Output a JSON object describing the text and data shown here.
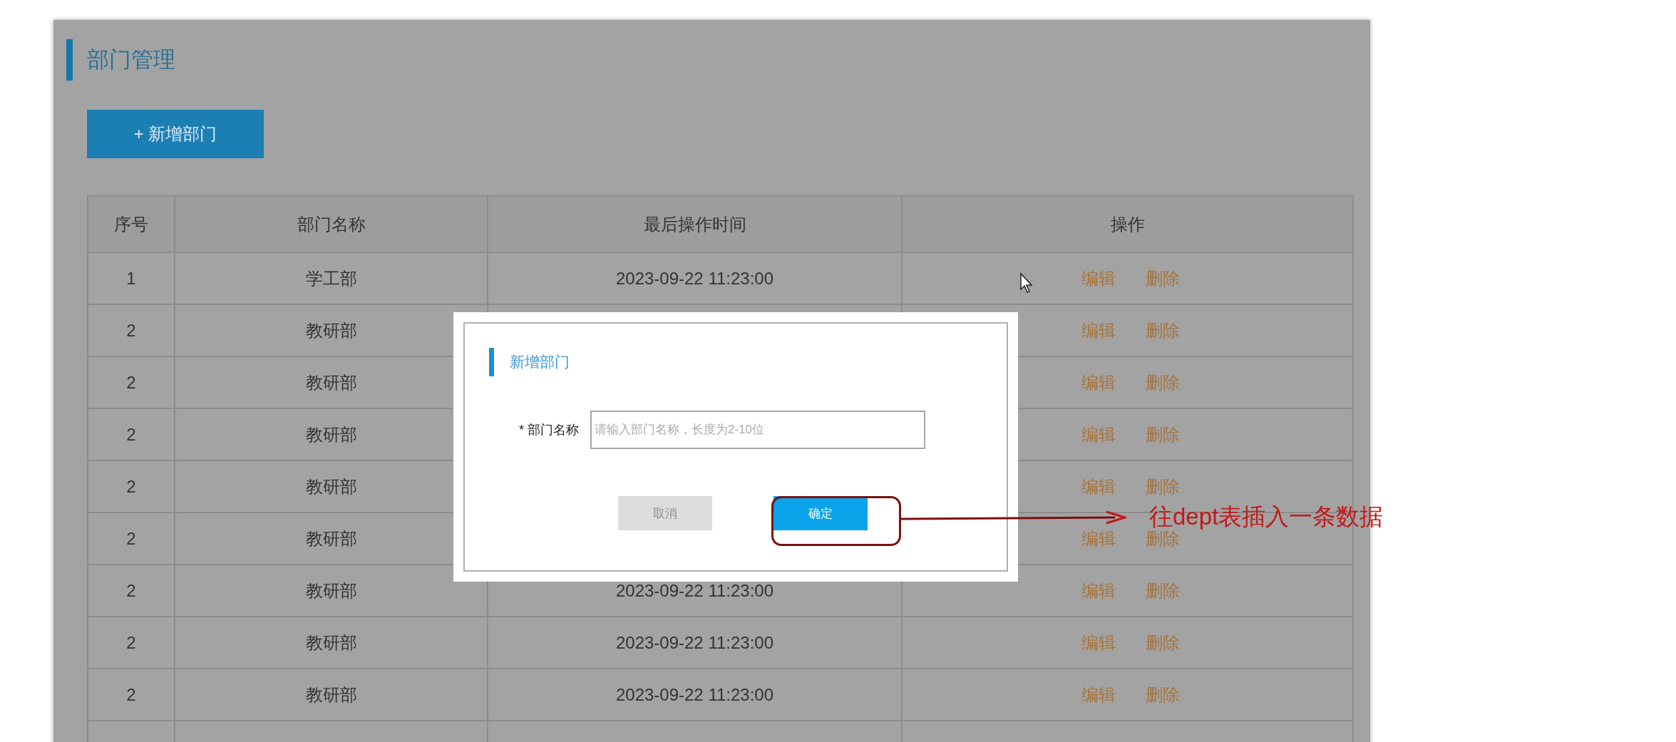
{
  "page": {
    "title": "部门管理",
    "add_button": "+ 新增部门"
  },
  "table": {
    "columns": [
      "序号",
      "部门名称",
      "最后操作时间",
      "操作"
    ],
    "rows": [
      {
        "index": "1",
        "name": "学工部",
        "time": "2023-09-22 11:23:00",
        "actions": [
          "编辑",
          "删除"
        ]
      },
      {
        "index": "2",
        "name": "教研部",
        "actions": [
          "编辑",
          "删除"
        ]
      },
      {
        "index": "2",
        "name": "教研部",
        "actions": [
          "编辑",
          "删除"
        ]
      },
      {
        "index": "2",
        "name": "教研部",
        "actions": [
          "编辑",
          "删除"
        ]
      },
      {
        "index": "2",
        "name": "教研部",
        "actions": [
          "编辑",
          "删除"
        ]
      },
      {
        "index": "2",
        "name": "教研部",
        "actions": [
          "编辑",
          "删除"
        ]
      },
      {
        "index": "2",
        "name": "教研部",
        "time": "2023-09-22 11:23:00",
        "actions": [
          "编辑",
          "删除"
        ]
      },
      {
        "index": "2",
        "name": "教研部",
        "time": "2023-09-22 11:23:00",
        "actions": [
          "编辑",
          "删除"
        ]
      },
      {
        "index": "2",
        "name": "教研部",
        "time": "2023-09-22 11:23:00",
        "actions": [
          "编辑",
          "删除"
        ]
      }
    ]
  },
  "dialog": {
    "title": "新增部门",
    "field": {
      "label": "* 部门名称",
      "placeholder": "请输入部门名称，长度为2-10位"
    },
    "buttons": [
      {
        "label": "取消",
        "kind": "cancel"
      },
      {
        "label": "确定",
        "kind": "confirm"
      }
    ]
  },
  "annotation": {
    "text": "往dept表插入一条数据"
  }
}
